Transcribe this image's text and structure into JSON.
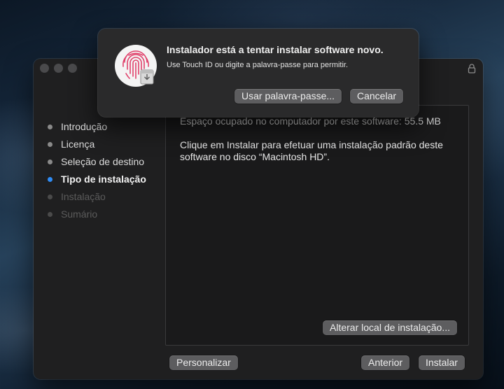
{
  "installer": {
    "steps": [
      {
        "label": "Introdução",
        "state": "done"
      },
      {
        "label": "Licença",
        "state": "done"
      },
      {
        "label": "Seleção de destino",
        "state": "done"
      },
      {
        "label": "Tipo de instalação",
        "state": "active"
      },
      {
        "label": "Instalação",
        "state": "future"
      },
      {
        "label": "Sumário",
        "state": "future"
      }
    ],
    "space_label": "Espaço ocupado no computador por este software:",
    "space_value": "55.5 MB",
    "instruction": "Clique em Instalar para efetuar uma instalação padrão deste software no disco “Macintosh HD”.",
    "change_location_label": "Alterar local de instalação...",
    "customize_label": "Personalizar",
    "back_label": "Anterior",
    "install_label": "Instalar"
  },
  "alert": {
    "title": "Instalador está a tentar instalar software novo.",
    "message": "Use Touch ID ou digite a palavra-passe para permitir.",
    "use_password_label": "Usar palavra-passe...",
    "cancel_label": "Cancelar",
    "icon": "touch-id-fingerprint-icon"
  },
  "colors": {
    "active_step": "#2f8cf5",
    "fingerprint": "#e0416b"
  }
}
